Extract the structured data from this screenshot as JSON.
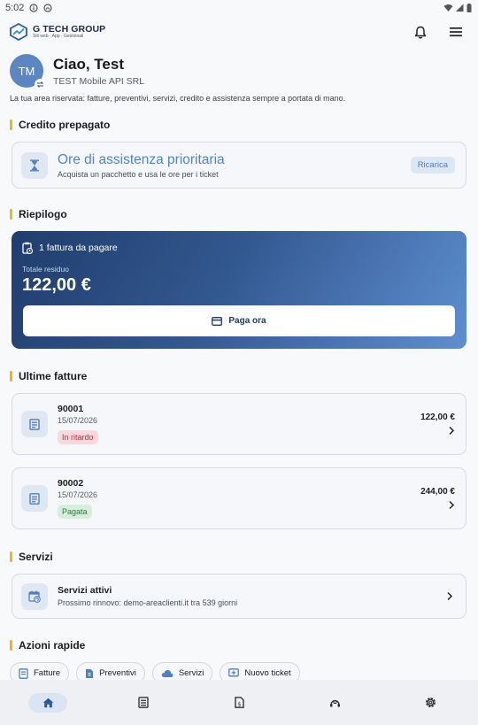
{
  "status_bar": {
    "time": "5:02"
  },
  "app": {
    "logo_name": "G TECH GROUP",
    "logo_tagline": "Siti web · App · Gestionali"
  },
  "profile": {
    "initials": "TM",
    "greeting": "Ciao, Test",
    "company": "TEST Mobile API SRL",
    "intro": "La tua area riservata: fatture, preventivi, servizi, credito e assistenza sempre a portata di mano."
  },
  "credit": {
    "section_title": "Credito prepagato",
    "title": "Ore di assistenza prioritaria",
    "subtitle": "Acquista un pacchetto e usa le ore per i ticket",
    "button": "Ricarica"
  },
  "summary": {
    "section_title": "Riepilogo",
    "pending": "1 fattura da pagare",
    "label": "Totale residuo",
    "amount": "122,00 €",
    "pay_button": "Paga ora"
  },
  "invoices": {
    "section_title": "Ultime fatture",
    "items": [
      {
        "number": "90001",
        "date": "15/07/2026",
        "status": "In ritardo",
        "status_color": "#b3323f",
        "amount": "122,00 €"
      },
      {
        "number": "90002",
        "date": "15/07/2026",
        "status": "Pagata",
        "status_color": "#2d7a3c",
        "amount": "244,00 €"
      }
    ]
  },
  "services": {
    "section_title": "Servizi",
    "title": "Servizi attivi",
    "subtitle": "Prossimo rinnovo: demo-areaclienti.it tra 539 giorni"
  },
  "quick_actions": {
    "section_title": "Azioni rapide",
    "items": [
      "Fatture",
      "Preventivi",
      "Servizi",
      "Nuovo ticket"
    ]
  },
  "bottom_nav": {
    "items": [
      {
        "icon": "home-icon",
        "active": true
      },
      {
        "icon": "invoice-icon",
        "active": false
      },
      {
        "icon": "quote-icon",
        "active": false
      },
      {
        "icon": "support-icon",
        "active": false
      },
      {
        "icon": "gear-icon",
        "active": false
      }
    ]
  },
  "colors": {
    "accent": "#4f86c7",
    "section_marker": "#f1b526",
    "summary_gradient_start": "#203d6c",
    "summary_gradient_end": "#5e8fd0"
  }
}
